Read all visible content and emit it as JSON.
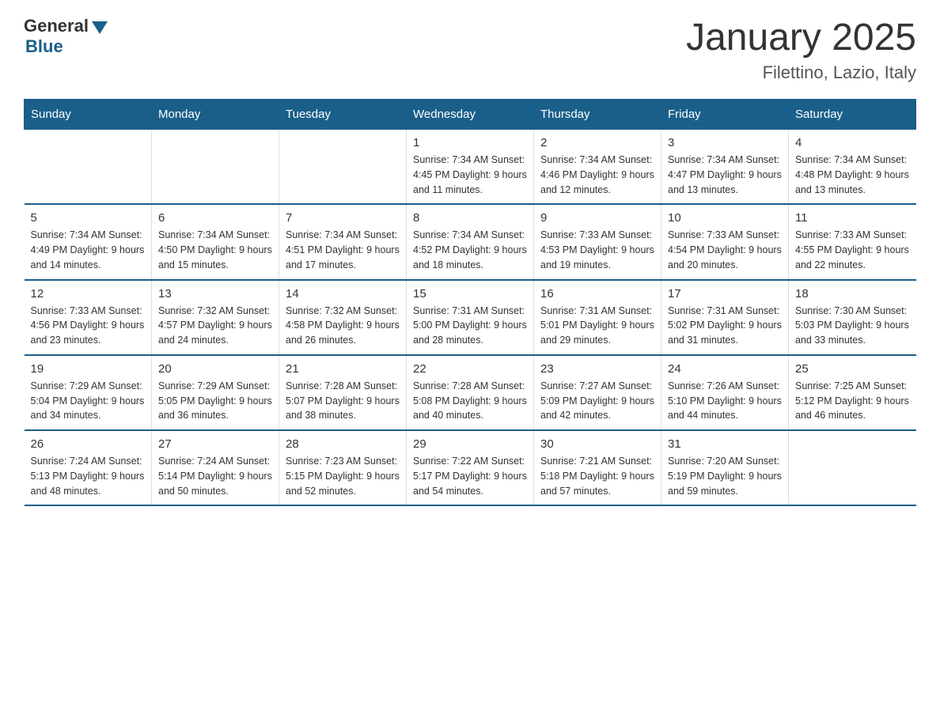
{
  "logo": {
    "general": "General",
    "blue": "Blue"
  },
  "title": "January 2025",
  "subtitle": "Filettino, Lazio, Italy",
  "days_header": [
    "Sunday",
    "Monday",
    "Tuesday",
    "Wednesday",
    "Thursday",
    "Friday",
    "Saturday"
  ],
  "weeks": [
    [
      {
        "day": "",
        "info": ""
      },
      {
        "day": "",
        "info": ""
      },
      {
        "day": "",
        "info": ""
      },
      {
        "day": "1",
        "info": "Sunrise: 7:34 AM\nSunset: 4:45 PM\nDaylight: 9 hours\nand 11 minutes."
      },
      {
        "day": "2",
        "info": "Sunrise: 7:34 AM\nSunset: 4:46 PM\nDaylight: 9 hours\nand 12 minutes."
      },
      {
        "day": "3",
        "info": "Sunrise: 7:34 AM\nSunset: 4:47 PM\nDaylight: 9 hours\nand 13 minutes."
      },
      {
        "day": "4",
        "info": "Sunrise: 7:34 AM\nSunset: 4:48 PM\nDaylight: 9 hours\nand 13 minutes."
      }
    ],
    [
      {
        "day": "5",
        "info": "Sunrise: 7:34 AM\nSunset: 4:49 PM\nDaylight: 9 hours\nand 14 minutes."
      },
      {
        "day": "6",
        "info": "Sunrise: 7:34 AM\nSunset: 4:50 PM\nDaylight: 9 hours\nand 15 minutes."
      },
      {
        "day": "7",
        "info": "Sunrise: 7:34 AM\nSunset: 4:51 PM\nDaylight: 9 hours\nand 17 minutes."
      },
      {
        "day": "8",
        "info": "Sunrise: 7:34 AM\nSunset: 4:52 PM\nDaylight: 9 hours\nand 18 minutes."
      },
      {
        "day": "9",
        "info": "Sunrise: 7:33 AM\nSunset: 4:53 PM\nDaylight: 9 hours\nand 19 minutes."
      },
      {
        "day": "10",
        "info": "Sunrise: 7:33 AM\nSunset: 4:54 PM\nDaylight: 9 hours\nand 20 minutes."
      },
      {
        "day": "11",
        "info": "Sunrise: 7:33 AM\nSunset: 4:55 PM\nDaylight: 9 hours\nand 22 minutes."
      }
    ],
    [
      {
        "day": "12",
        "info": "Sunrise: 7:33 AM\nSunset: 4:56 PM\nDaylight: 9 hours\nand 23 minutes."
      },
      {
        "day": "13",
        "info": "Sunrise: 7:32 AM\nSunset: 4:57 PM\nDaylight: 9 hours\nand 24 minutes."
      },
      {
        "day": "14",
        "info": "Sunrise: 7:32 AM\nSunset: 4:58 PM\nDaylight: 9 hours\nand 26 minutes."
      },
      {
        "day": "15",
        "info": "Sunrise: 7:31 AM\nSunset: 5:00 PM\nDaylight: 9 hours\nand 28 minutes."
      },
      {
        "day": "16",
        "info": "Sunrise: 7:31 AM\nSunset: 5:01 PM\nDaylight: 9 hours\nand 29 minutes."
      },
      {
        "day": "17",
        "info": "Sunrise: 7:31 AM\nSunset: 5:02 PM\nDaylight: 9 hours\nand 31 minutes."
      },
      {
        "day": "18",
        "info": "Sunrise: 7:30 AM\nSunset: 5:03 PM\nDaylight: 9 hours\nand 33 minutes."
      }
    ],
    [
      {
        "day": "19",
        "info": "Sunrise: 7:29 AM\nSunset: 5:04 PM\nDaylight: 9 hours\nand 34 minutes."
      },
      {
        "day": "20",
        "info": "Sunrise: 7:29 AM\nSunset: 5:05 PM\nDaylight: 9 hours\nand 36 minutes."
      },
      {
        "day": "21",
        "info": "Sunrise: 7:28 AM\nSunset: 5:07 PM\nDaylight: 9 hours\nand 38 minutes."
      },
      {
        "day": "22",
        "info": "Sunrise: 7:28 AM\nSunset: 5:08 PM\nDaylight: 9 hours\nand 40 minutes."
      },
      {
        "day": "23",
        "info": "Sunrise: 7:27 AM\nSunset: 5:09 PM\nDaylight: 9 hours\nand 42 minutes."
      },
      {
        "day": "24",
        "info": "Sunrise: 7:26 AM\nSunset: 5:10 PM\nDaylight: 9 hours\nand 44 minutes."
      },
      {
        "day": "25",
        "info": "Sunrise: 7:25 AM\nSunset: 5:12 PM\nDaylight: 9 hours\nand 46 minutes."
      }
    ],
    [
      {
        "day": "26",
        "info": "Sunrise: 7:24 AM\nSunset: 5:13 PM\nDaylight: 9 hours\nand 48 minutes."
      },
      {
        "day": "27",
        "info": "Sunrise: 7:24 AM\nSunset: 5:14 PM\nDaylight: 9 hours\nand 50 minutes."
      },
      {
        "day": "28",
        "info": "Sunrise: 7:23 AM\nSunset: 5:15 PM\nDaylight: 9 hours\nand 52 minutes."
      },
      {
        "day": "29",
        "info": "Sunrise: 7:22 AM\nSunset: 5:17 PM\nDaylight: 9 hours\nand 54 minutes."
      },
      {
        "day": "30",
        "info": "Sunrise: 7:21 AM\nSunset: 5:18 PM\nDaylight: 9 hours\nand 57 minutes."
      },
      {
        "day": "31",
        "info": "Sunrise: 7:20 AM\nSunset: 5:19 PM\nDaylight: 9 hours\nand 59 minutes."
      },
      {
        "day": "",
        "info": ""
      }
    ]
  ]
}
